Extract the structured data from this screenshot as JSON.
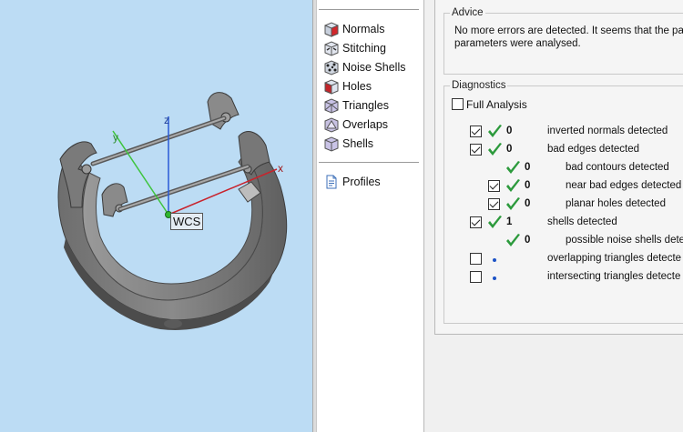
{
  "viewport": {
    "axis_labels": {
      "x": "x",
      "y": "y",
      "z": "z"
    },
    "wcs_label": "WCS",
    "axis_colors": {
      "x": "#c8232c",
      "y": "#3ec43e",
      "z": "#2a5ad6"
    },
    "background": "#bcdcf4"
  },
  "tools": {
    "items": [
      {
        "label": "Normals",
        "icon": "normals-icon"
      },
      {
        "label": "Stitching",
        "icon": "stitching-icon"
      },
      {
        "label": "Noise Shells",
        "icon": "noise-shells-icon"
      },
      {
        "label": "Holes",
        "icon": "holes-icon"
      },
      {
        "label": "Triangles",
        "icon": "triangles-icon"
      },
      {
        "label": "Overlaps",
        "icon": "overlaps-icon"
      },
      {
        "label": "Shells",
        "icon": "shells-icon"
      }
    ],
    "profiles": {
      "label": "Profiles",
      "icon": "profiles-icon"
    }
  },
  "advice": {
    "title": "Advice",
    "line1": "No more errors are detected. It seems that the pa",
    "line2": "parameters were analysed."
  },
  "diagnostics": {
    "title": "Diagnostics",
    "full_analysis": {
      "label": "Full Analysis",
      "checked": false
    },
    "rows": [
      {
        "checked": true,
        "status": "ok",
        "count": "0",
        "label": "inverted normals detected"
      },
      {
        "checked": true,
        "status": "ok",
        "count": "0",
        "label": "bad edges detected"
      },
      {
        "checked": null,
        "status": "ok",
        "count": "0",
        "label": "bad contours detected"
      },
      {
        "checked": true,
        "status": "ok",
        "count": "0",
        "label": "near bad edges detected"
      },
      {
        "checked": true,
        "status": "ok",
        "count": "0",
        "label": "planar holes detected"
      },
      {
        "checked": true,
        "status": "ok",
        "count": "1",
        "label": "shells detected"
      },
      {
        "checked": null,
        "status": "ok",
        "count": "0",
        "label": "possible noise shells detec"
      },
      {
        "checked": false,
        "status": "pending",
        "count": "",
        "label": "overlapping triangles detecte"
      },
      {
        "checked": false,
        "status": "pending",
        "count": "",
        "label": "intersecting triangles detecte"
      }
    ]
  }
}
